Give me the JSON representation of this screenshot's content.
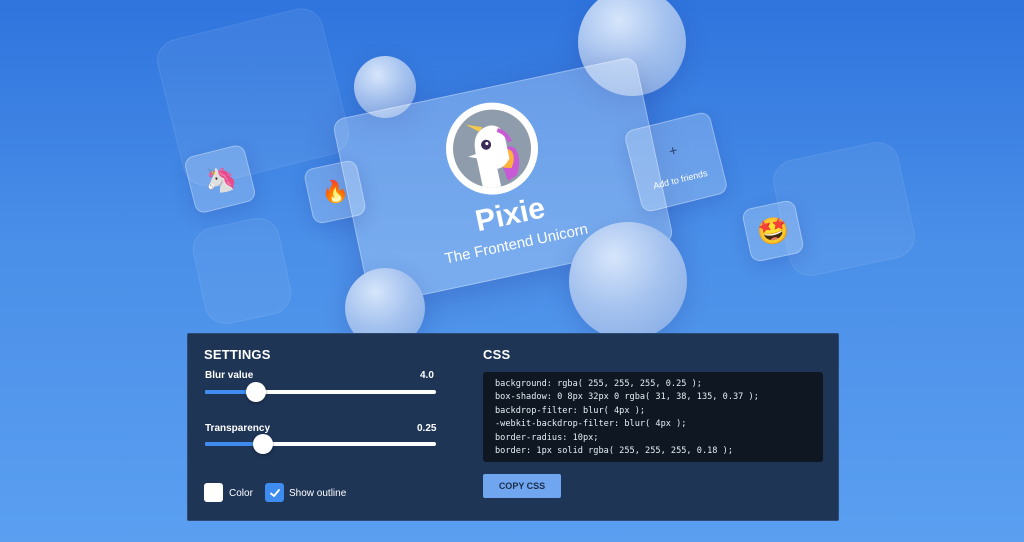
{
  "card": {
    "name": "Pixie",
    "subtitle": "The Frontend Unicorn"
  },
  "tiles": {
    "unicorn_emoji": "🦄",
    "fire_emoji": "🔥",
    "friends_plus": "+",
    "friends_label": "Add to friends",
    "star_emoji": "🤩"
  },
  "settings": {
    "title": "SETTINGS",
    "blur": {
      "label": "Blur value",
      "value": "4.0",
      "fraction": 0.22
    },
    "transparency": {
      "label": "Transparency",
      "value": "0.25",
      "fraction": 0.25
    },
    "color_label": "Color",
    "show_outline_label": "Show outline",
    "show_outline_checked": true
  },
  "css": {
    "title": "CSS",
    "lines": [
      "background: rgba( 255, 255, 255, 0.25 );",
      "box-shadow: 0 8px 32px 0 rgba( 31, 38, 135, 0.37 );",
      "backdrop-filter: blur( 4px );",
      "-webkit-backdrop-filter: blur( 4px );",
      "border-radius: 10px;",
      "border: 1px solid rgba( 255, 255, 255, 0.18 );"
    ],
    "copy_button": "COPY CSS"
  },
  "colors": {
    "accent": "#3e8cf0",
    "panel_bg": "#1e3556",
    "code_bg": "#0f1822",
    "button_bg": "#6fa6ef"
  }
}
